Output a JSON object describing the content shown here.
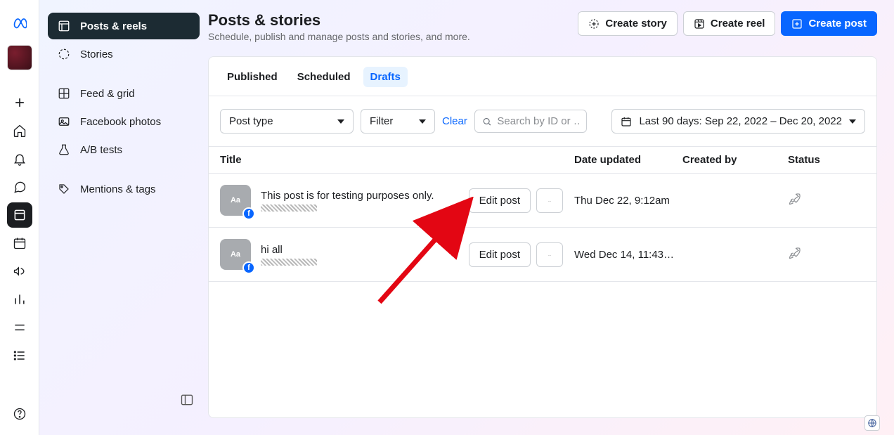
{
  "header": {
    "title": "Posts & stories",
    "subtitle": "Schedule, publish and manage posts and stories, and more.",
    "create_story": "Create story",
    "create_reel": "Create reel",
    "create_post": "Create post"
  },
  "sidenav": {
    "posts_reels": "Posts & reels",
    "stories": "Stories",
    "feed_grid": "Feed & grid",
    "fb_photos": "Facebook photos",
    "ab_tests": "A/B tests",
    "mentions_tags": "Mentions & tags"
  },
  "tabs": {
    "published": "Published",
    "scheduled": "Scheduled",
    "drafts": "Drafts"
  },
  "toolbar": {
    "post_type": "Post type",
    "filter": "Filter",
    "clear": "Clear",
    "search_placeholder": "Search by ID or …",
    "date_range": "Last 90 days: Sep 22, 2022 – Dec 20, 2022"
  },
  "columns": {
    "title": "Title",
    "date_updated": "Date updated",
    "created_by": "Created by",
    "status": "Status"
  },
  "rows": [
    {
      "title": "This post is for testing purposes only.",
      "date": "Thu Dec 22, 9:12am",
      "edit": "Edit post"
    },
    {
      "title": "hi all",
      "date": "Wed Dec 14, 11:43…",
      "edit": "Edit post"
    }
  ],
  "thumb_label": "Aa"
}
